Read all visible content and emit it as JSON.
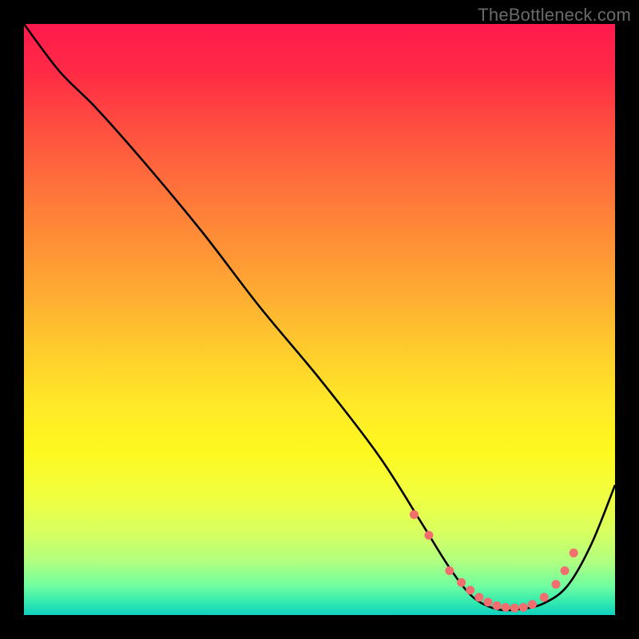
{
  "attribution": "TheBottleneck.com",
  "chart_data": {
    "type": "line",
    "title": "",
    "xlabel": "",
    "ylabel": "",
    "xlim": [
      0,
      100
    ],
    "ylim": [
      0,
      100
    ],
    "series": [
      {
        "name": "curve",
        "x": [
          0,
          6,
          12,
          20,
          30,
          40,
          50,
          60,
          67,
          72,
          76,
          80,
          84,
          88,
          92,
          96,
          100
        ],
        "y": [
          100,
          92,
          86,
          77,
          65,
          52,
          40,
          27,
          16,
          8,
          3,
          1,
          1,
          2,
          5,
          12,
          22
        ]
      }
    ],
    "markers": {
      "name": "dots",
      "x": [
        66,
        68.5,
        72,
        74,
        75.5,
        77,
        78.5,
        80,
        81.5,
        83,
        84.5,
        86,
        88,
        90,
        91.5,
        93
      ],
      "y": [
        17,
        13.5,
        7.5,
        5.5,
        4.2,
        3.0,
        2.2,
        1.6,
        1.3,
        1.2,
        1.3,
        1.8,
        3.0,
        5.2,
        7.5,
        10.5
      ]
    },
    "gradient_stops": [
      {
        "pos": 0,
        "color": "#ff1a4d"
      },
      {
        "pos": 18,
        "color": "#ff5040"
      },
      {
        "pos": 42,
        "color": "#ffa034"
      },
      {
        "pos": 64,
        "color": "#ffe828"
      },
      {
        "pos": 86,
        "color": "#d8ff60"
      },
      {
        "pos": 100,
        "color": "#10d0c0"
      }
    ],
    "marker_color": "#f26d6d",
    "line_color": "#000000"
  }
}
